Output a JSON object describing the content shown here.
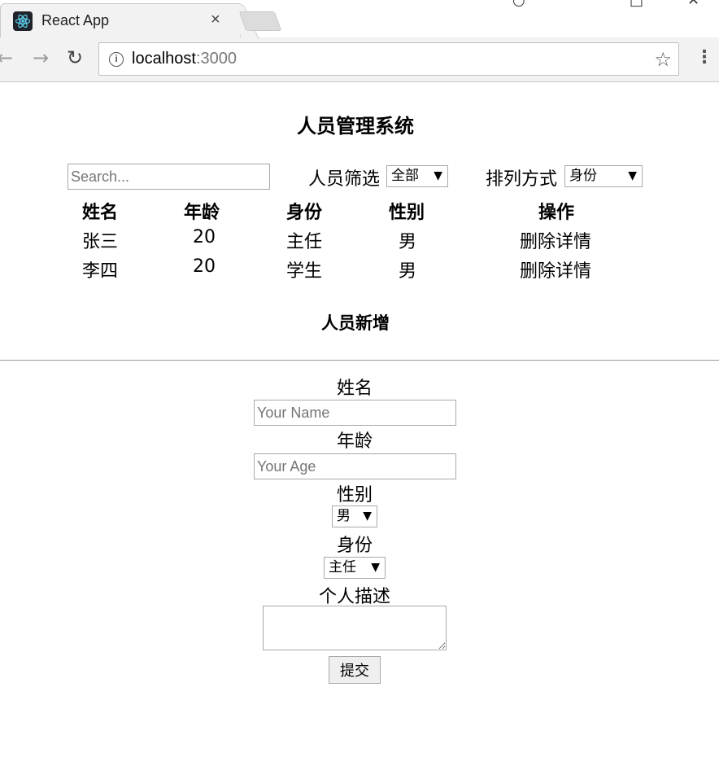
{
  "browser": {
    "tab_title": "React App",
    "tab_close": "×",
    "favicon": "react-logo-icon",
    "url_host": "localhost",
    "url_port": ":3000",
    "back_glyph": "←",
    "forward_glyph": "→",
    "reload_glyph": "↻",
    "star_glyph": "☆",
    "menu_glyph": "⋮",
    "info_glyph": "i",
    "window_glyphs": [
      "○",
      "□",
      "✕"
    ]
  },
  "page": {
    "title": "人员管理系统",
    "search": {
      "placeholder": "Search..."
    },
    "filter": {
      "label": "人员筛选",
      "selected": "全部"
    },
    "sort": {
      "label": "排列方式",
      "selected": "身份"
    },
    "select_arrow": "▼",
    "table": {
      "headers": [
        "姓名",
        "年龄",
        "身份",
        "性别",
        "操作"
      ],
      "rows": [
        {
          "name": "张三",
          "age": "20",
          "role": "主任",
          "gender": "男",
          "actions": "删除详情"
        },
        {
          "name": "李四",
          "age": "20",
          "role": "学生",
          "gender": "男",
          "actions": "删除详情"
        }
      ]
    },
    "add_section_title": "人员新增",
    "form": {
      "name_label": "姓名",
      "name_placeholder": "Your Name",
      "age_label": "年龄",
      "age_placeholder": "Your Age",
      "gender_label": "性别",
      "gender_selected": "男",
      "role_label": "身份",
      "role_selected": "主任",
      "desc_label": "个人描述",
      "submit_label": "提交"
    }
  },
  "colors": {
    "favicon_bg": "#20232a",
    "react_blue": "#61dafb"
  }
}
